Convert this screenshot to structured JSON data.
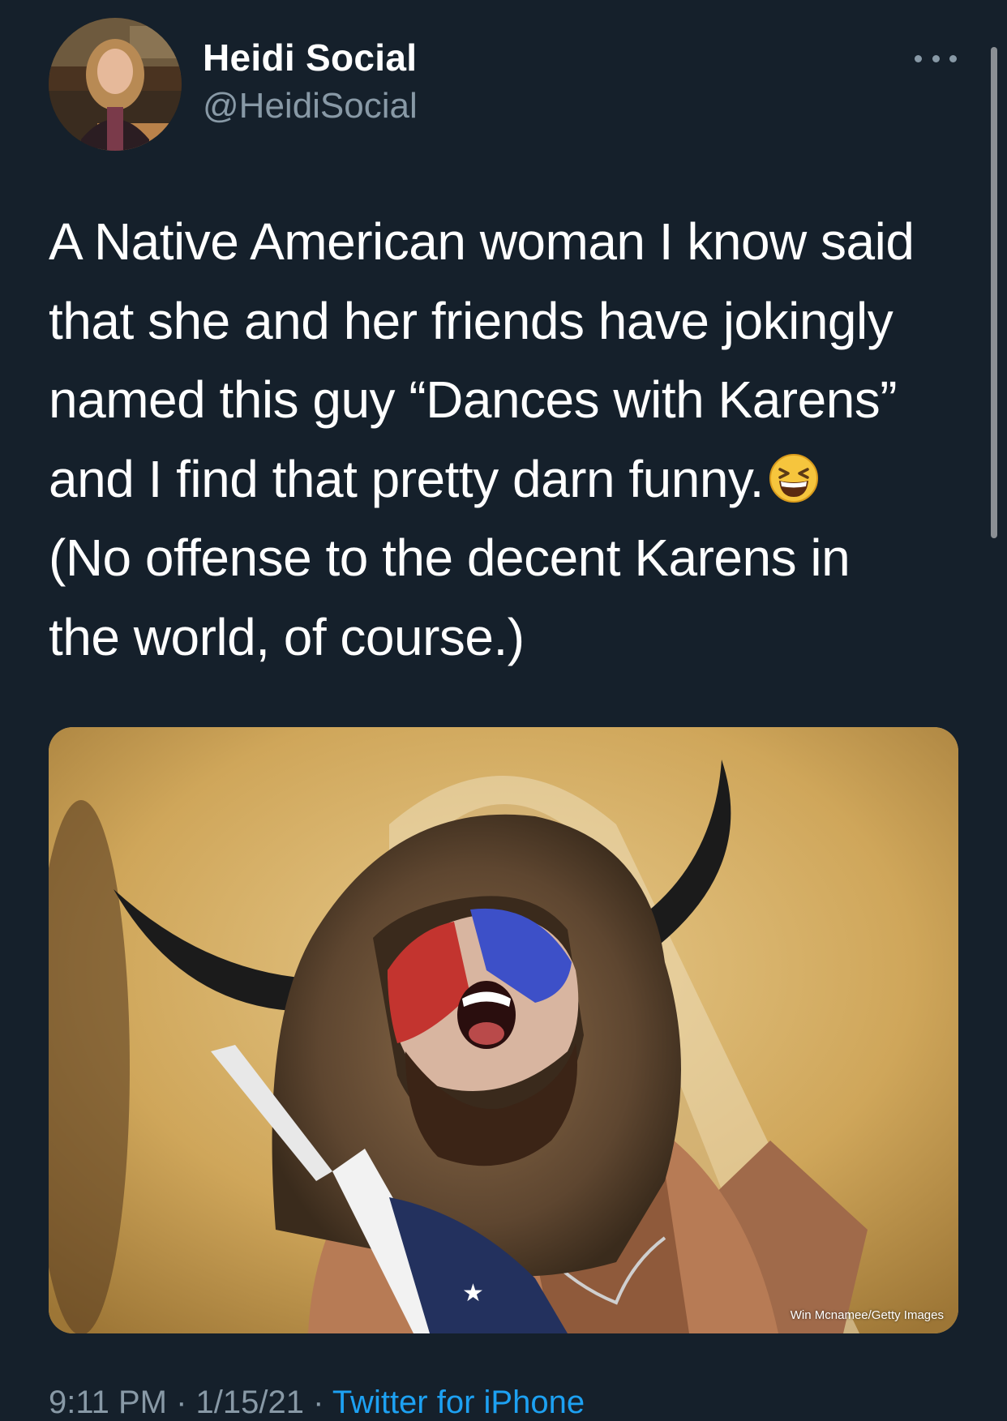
{
  "tweet": {
    "author_name": "Heidi Social",
    "author_handle": "@HeidiSocial",
    "text_lines": [
      "A Native American woman I know said",
      "that she and her friends have jokingly",
      "named this guy “Dances with Karens”",
      "and I find that pretty darn funny.",
      "(No offense to the decent Karens in",
      "the world, of course.)"
    ],
    "emoji": "grinning-squinting-face",
    "media_credit": "Win Mcnamee/Getty Images",
    "footer": {
      "timestamp": "9:11 PM · 1/15/21 ·",
      "source": "Twitter for iPhone"
    }
  },
  "icons": {
    "more": "more-horizontal-icon"
  },
  "colors": {
    "background": "#15202b",
    "text_primary": "#ffffff",
    "text_secondary": "#8899a6",
    "link": "#1da1f2"
  }
}
